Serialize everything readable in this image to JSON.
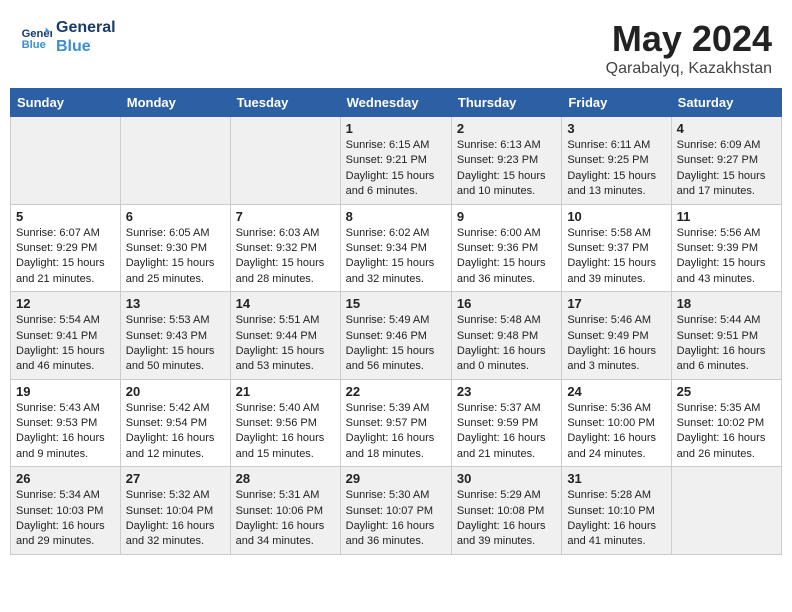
{
  "header": {
    "logo_line1": "General",
    "logo_line2": "Blue",
    "month": "May 2024",
    "location": "Qarabalyq, Kazakhstan"
  },
  "days_of_week": [
    "Sunday",
    "Monday",
    "Tuesday",
    "Wednesday",
    "Thursday",
    "Friday",
    "Saturday"
  ],
  "weeks": [
    [
      {
        "day": "",
        "content": ""
      },
      {
        "day": "",
        "content": ""
      },
      {
        "day": "",
        "content": ""
      },
      {
        "day": "1",
        "content": "Sunrise: 6:15 AM\nSunset: 9:21 PM\nDaylight: 15 hours\nand 6 minutes."
      },
      {
        "day": "2",
        "content": "Sunrise: 6:13 AM\nSunset: 9:23 PM\nDaylight: 15 hours\nand 10 minutes."
      },
      {
        "day": "3",
        "content": "Sunrise: 6:11 AM\nSunset: 9:25 PM\nDaylight: 15 hours\nand 13 minutes."
      },
      {
        "day": "4",
        "content": "Sunrise: 6:09 AM\nSunset: 9:27 PM\nDaylight: 15 hours\nand 17 minutes."
      }
    ],
    [
      {
        "day": "5",
        "content": "Sunrise: 6:07 AM\nSunset: 9:29 PM\nDaylight: 15 hours\nand 21 minutes."
      },
      {
        "day": "6",
        "content": "Sunrise: 6:05 AM\nSunset: 9:30 PM\nDaylight: 15 hours\nand 25 minutes."
      },
      {
        "day": "7",
        "content": "Sunrise: 6:03 AM\nSunset: 9:32 PM\nDaylight: 15 hours\nand 28 minutes."
      },
      {
        "day": "8",
        "content": "Sunrise: 6:02 AM\nSunset: 9:34 PM\nDaylight: 15 hours\nand 32 minutes."
      },
      {
        "day": "9",
        "content": "Sunrise: 6:00 AM\nSunset: 9:36 PM\nDaylight: 15 hours\nand 36 minutes."
      },
      {
        "day": "10",
        "content": "Sunrise: 5:58 AM\nSunset: 9:37 PM\nDaylight: 15 hours\nand 39 minutes."
      },
      {
        "day": "11",
        "content": "Sunrise: 5:56 AM\nSunset: 9:39 PM\nDaylight: 15 hours\nand 43 minutes."
      }
    ],
    [
      {
        "day": "12",
        "content": "Sunrise: 5:54 AM\nSunset: 9:41 PM\nDaylight: 15 hours\nand 46 minutes."
      },
      {
        "day": "13",
        "content": "Sunrise: 5:53 AM\nSunset: 9:43 PM\nDaylight: 15 hours\nand 50 minutes."
      },
      {
        "day": "14",
        "content": "Sunrise: 5:51 AM\nSunset: 9:44 PM\nDaylight: 15 hours\nand 53 minutes."
      },
      {
        "day": "15",
        "content": "Sunrise: 5:49 AM\nSunset: 9:46 PM\nDaylight: 15 hours\nand 56 minutes."
      },
      {
        "day": "16",
        "content": "Sunrise: 5:48 AM\nSunset: 9:48 PM\nDaylight: 16 hours\nand 0 minutes."
      },
      {
        "day": "17",
        "content": "Sunrise: 5:46 AM\nSunset: 9:49 PM\nDaylight: 16 hours\nand 3 minutes."
      },
      {
        "day": "18",
        "content": "Sunrise: 5:44 AM\nSunset: 9:51 PM\nDaylight: 16 hours\nand 6 minutes."
      }
    ],
    [
      {
        "day": "19",
        "content": "Sunrise: 5:43 AM\nSunset: 9:53 PM\nDaylight: 16 hours\nand 9 minutes."
      },
      {
        "day": "20",
        "content": "Sunrise: 5:42 AM\nSunset: 9:54 PM\nDaylight: 16 hours\nand 12 minutes."
      },
      {
        "day": "21",
        "content": "Sunrise: 5:40 AM\nSunset: 9:56 PM\nDaylight: 16 hours\nand 15 minutes."
      },
      {
        "day": "22",
        "content": "Sunrise: 5:39 AM\nSunset: 9:57 PM\nDaylight: 16 hours\nand 18 minutes."
      },
      {
        "day": "23",
        "content": "Sunrise: 5:37 AM\nSunset: 9:59 PM\nDaylight: 16 hours\nand 21 minutes."
      },
      {
        "day": "24",
        "content": "Sunrise: 5:36 AM\nSunset: 10:00 PM\nDaylight: 16 hours\nand 24 minutes."
      },
      {
        "day": "25",
        "content": "Sunrise: 5:35 AM\nSunset: 10:02 PM\nDaylight: 16 hours\nand 26 minutes."
      }
    ],
    [
      {
        "day": "26",
        "content": "Sunrise: 5:34 AM\nSunset: 10:03 PM\nDaylight: 16 hours\nand 29 minutes."
      },
      {
        "day": "27",
        "content": "Sunrise: 5:32 AM\nSunset: 10:04 PM\nDaylight: 16 hours\nand 32 minutes."
      },
      {
        "day": "28",
        "content": "Sunrise: 5:31 AM\nSunset: 10:06 PM\nDaylight: 16 hours\nand 34 minutes."
      },
      {
        "day": "29",
        "content": "Sunrise: 5:30 AM\nSunset: 10:07 PM\nDaylight: 16 hours\nand 36 minutes."
      },
      {
        "day": "30",
        "content": "Sunrise: 5:29 AM\nSunset: 10:08 PM\nDaylight: 16 hours\nand 39 minutes."
      },
      {
        "day": "31",
        "content": "Sunrise: 5:28 AM\nSunset: 10:10 PM\nDaylight: 16 hours\nand 41 minutes."
      },
      {
        "day": "",
        "content": ""
      }
    ]
  ]
}
